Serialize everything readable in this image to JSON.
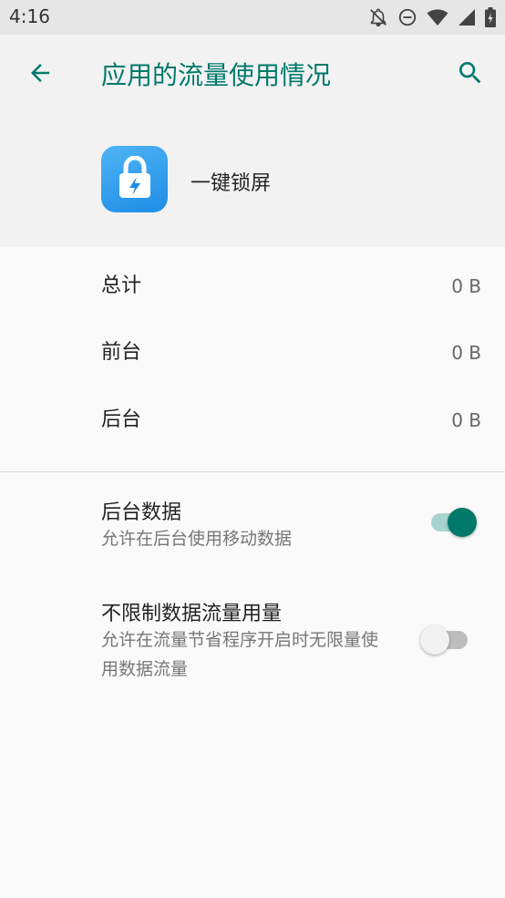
{
  "status_bar": {
    "time": "4:16",
    "icons": [
      "notifications-off-icon",
      "do-not-disturb-icon",
      "wifi-icon",
      "cell-signal-icon",
      "battery-icon"
    ]
  },
  "toolbar": {
    "title": "应用的流量使用情况",
    "back_icon": "back-arrow-icon",
    "search_icon": "search-icon",
    "accent_color": "#00796b"
  },
  "app": {
    "name": "一键锁屏",
    "icon": "lock-icon"
  },
  "usage": [
    {
      "label": "总计",
      "value": "0 B"
    },
    {
      "label": "前台",
      "value": "0 B"
    },
    {
      "label": "后台",
      "value": "0 B"
    }
  ],
  "settings": {
    "background_data": {
      "title": "后台数据",
      "summary": "允许在后台使用移动数据",
      "enabled": true
    },
    "unrestricted_data": {
      "title": "不限制数据流量用量",
      "summary": "允许在流量节省程序开启时无限量使用数据流量",
      "enabled": false
    }
  }
}
